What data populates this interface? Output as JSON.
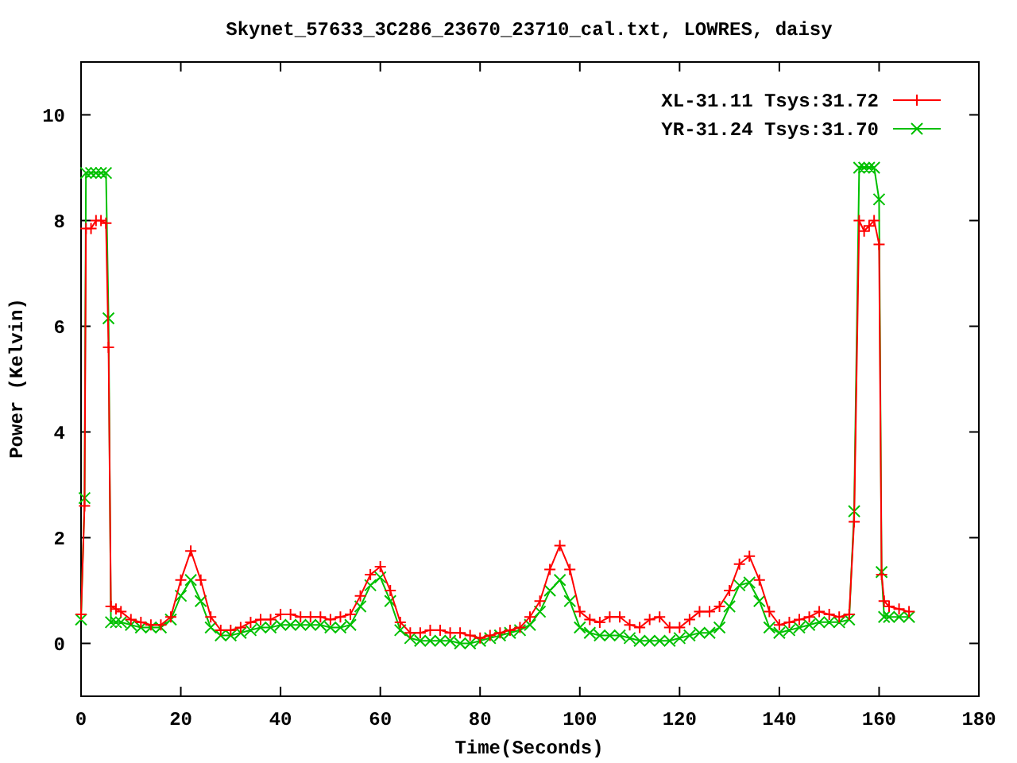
{
  "plot": {
    "chart_data": {
      "type": "line",
      "title": "Skynet_57633_3C286_23670_23710_cal.txt, LOWRES, daisy",
      "xlabel": "Time(Seconds)",
      "ylabel": "Power (Kelvin)",
      "x": [
        0,
        0.7,
        1,
        2,
        3,
        4,
        5,
        5.5,
        6,
        7,
        8,
        10,
        12,
        14,
        16,
        18,
        20,
        22,
        24,
        26,
        28,
        30,
        32,
        34,
        36,
        38,
        40,
        42,
        44,
        46,
        48,
        50,
        52,
        54,
        56,
        58,
        60,
        62,
        64,
        66,
        68,
        70,
        72,
        74,
        76,
        78,
        80,
        82,
        84,
        86,
        88,
        90,
        92,
        94,
        96,
        98,
        100,
        102,
        104,
        106,
        108,
        110,
        112,
        114,
        116,
        118,
        120,
        122,
        124,
        126,
        128,
        130,
        132,
        134,
        136,
        138,
        140,
        142,
        144,
        146,
        148,
        150,
        152,
        154,
        155,
        156,
        157,
        158,
        159,
        160,
        160.5,
        161,
        162,
        164,
        166
      ],
      "series": [
        {
          "name": "XL-31.11 Tsys:31.72",
          "color": "#ff0000",
          "marker": "plus",
          "values": [
            0.55,
            2.6,
            7.85,
            7.85,
            8.0,
            8.0,
            7.95,
            5.6,
            0.7,
            0.65,
            0.6,
            0.45,
            0.4,
            0.35,
            0.35,
            0.5,
            1.2,
            1.75,
            1.2,
            0.5,
            0.25,
            0.25,
            0.3,
            0.4,
            0.45,
            0.45,
            0.55,
            0.55,
            0.5,
            0.5,
            0.5,
            0.45,
            0.5,
            0.55,
            0.9,
            1.3,
            1.45,
            1.0,
            0.4,
            0.2,
            0.2,
            0.25,
            0.25,
            0.2,
            0.2,
            0.15,
            0.1,
            0.15,
            0.2,
            0.25,
            0.3,
            0.5,
            0.8,
            1.4,
            1.85,
            1.4,
            0.6,
            0.45,
            0.4,
            0.5,
            0.5,
            0.35,
            0.3,
            0.45,
            0.5,
            0.3,
            0.3,
            0.45,
            0.6,
            0.6,
            0.7,
            1.0,
            1.5,
            1.65,
            1.2,
            0.6,
            0.35,
            0.4,
            0.45,
            0.5,
            0.6,
            0.55,
            0.5,
            0.55,
            2.3,
            8.0,
            7.8,
            7.9,
            8.0,
            7.55,
            1.3,
            0.8,
            0.7,
            0.65,
            0.6
          ]
        },
        {
          "name": "YR-31.24 Tsys:31.70",
          "color": "#00c000",
          "marker": "cross",
          "values": [
            0.45,
            2.75,
            8.9,
            8.9,
            8.9,
            8.9,
            8.9,
            6.15,
            0.4,
            0.4,
            0.4,
            0.35,
            0.3,
            0.3,
            0.3,
            0.45,
            0.9,
            1.2,
            0.8,
            0.3,
            0.15,
            0.15,
            0.2,
            0.25,
            0.3,
            0.3,
            0.35,
            0.35,
            0.35,
            0.35,
            0.35,
            0.3,
            0.3,
            0.35,
            0.7,
            1.1,
            1.25,
            0.8,
            0.25,
            0.1,
            0.05,
            0.05,
            0.05,
            0.05,
            0.0,
            0.0,
            0.05,
            0.1,
            0.15,
            0.2,
            0.25,
            0.35,
            0.6,
            1.0,
            1.2,
            0.8,
            0.3,
            0.2,
            0.15,
            0.15,
            0.15,
            0.1,
            0.05,
            0.05,
            0.05,
            0.05,
            0.1,
            0.15,
            0.2,
            0.2,
            0.3,
            0.7,
            1.1,
            1.15,
            0.8,
            0.3,
            0.2,
            0.25,
            0.3,
            0.35,
            0.4,
            0.4,
            0.4,
            0.45,
            2.5,
            9.0,
            9.0,
            9.0,
            9.0,
            8.4,
            1.35,
            0.5,
            0.5,
            0.5,
            0.5
          ]
        }
      ],
      "legend": true,
      "xlim": [
        0,
        180
      ],
      "ylim": [
        -1,
        11
      ],
      "xticks": [
        0,
        20,
        40,
        60,
        80,
        100,
        120,
        140,
        160,
        180
      ],
      "yticks": [
        0,
        2,
        4,
        6,
        8,
        10
      ]
    }
  }
}
